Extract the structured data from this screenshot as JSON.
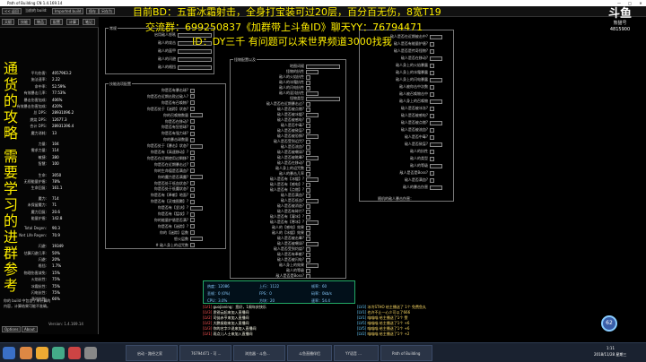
{
  "window": {
    "title": "Path of Building CN 1.4.169.14",
    "controls": [
      "—",
      "□",
      "✕"
    ]
  },
  "toolbar": {
    "buttons": [
      "<< 返回",
      "当前的 build:",
      "Imported build",
      "保存",
      "另存为",
      "天赋",
      "技能",
      "物品",
      "配置",
      "计算",
      "笔记"
    ]
  },
  "left_stats": [
    {
      "k": "平均伤害:",
      "v": "4057963.2"
    },
    {
      "k": "施法速率:",
      "v": "2.22"
    },
    {
      "k": "命中率:",
      "v": "52.59%"
    },
    {
      "k": "有效暴击几率:",
      "v": "77.53%"
    },
    {
      "k": "暴击伤害加成:",
      "v": "406%"
    },
    {
      "k": "有效暴击伤害加成:",
      "v": "420%"
    },
    {
      "k": "总 DPS:",
      "v": "28931096.2"
    },
    {
      "k": "燃烧 DPS:",
      "v": "12677.3"
    },
    {
      "k": "合计 DPS:",
      "v": "28931396.4"
    },
    {
      "k": "魔力消耗:",
      "v": "13"
    },
    {
      "k": "力量:",
      "v": "104"
    },
    {
      "k": "需求力量:",
      "v": "114"
    },
    {
      "k": "敏捷:",
      "v": "380"
    },
    {
      "k": "智慧:",
      "v": "100"
    },
    {
      "k": "生命:",
      "v": "3050"
    },
    {
      "k": "无视能量护盾:",
      "v": "78%"
    },
    {
      "k": "生命回复:",
      "v": "161.1"
    },
    {
      "k": "魔力:",
      "v": "714"
    },
    {
      "k": "未保留魔力:",
      "v": "71"
    },
    {
      "k": "魔力回复:",
      "v": "20.6"
    },
    {
      "k": "能量护盾:",
      "v": "142.8"
    },
    {
      "k": "Total Degen:",
      "v": "90.3"
    },
    {
      "k": "Net Life Regen:",
      "v": "70.9"
    },
    {
      "k": "闪避:",
      "v": "19349"
    },
    {
      "k": "估算闪避几率:",
      "v": "50%"
    },
    {
      "k": "闪避:",
      "v": "20%"
    },
    {
      "k": "格挡:",
      "v": "1.7%"
    },
    {
      "k": "物理伤害减免:",
      "v": "15%"
    },
    {
      "k": "火焰抗性:",
      "v": "75%"
    },
    {
      "k": "冰霜抗性:",
      "v": "75%"
    },
    {
      "k": "闪电抗性:",
      "v": "75%"
    },
    {
      "k": "混沌抗性:",
      "v": "66%"
    }
  ],
  "left_footer": {
    "msg1": "你的 build 中包含了未计算的",
    "msg2": "内容，计算结果可能不准确。",
    "version": "Version: 1.4.169.14",
    "options": "Options",
    "about": "About"
  },
  "panels": {
    "p1_title": "常规",
    "p1_rows": [
      "启用敌人怒吼",
      "敌人的攻击",
      "敌人的盔甲",
      "敌人的闪避",
      "敌人的格挡"
    ],
    "p2_title": "技能选项配置",
    "p2_rows": [
      "你是否有暴击球?",
      "你是否在近期击败过敌人?",
      "你是否有召唤物?",
      "你是否处于【迷踪】状态?",
      "你的召唤物数量",
      "你是否在移动?",
      "你是否有狂怒球?",
      "你是否有强力球?",
      "你的暴击球数量",
      "你是否处于【暴击】状态?",
      "你是否有【高速移动】?",
      "你是否在近期使用过瞬移?",
      "你是否在近期暴击过?",
      "你的生命值是否满血?",
      "你的魔力是否满魔?",
      "你是否处于低血状态?",
      "你是否处于低魔状态?",
      "你是否有【奉献】地面?",
      "你是否有【灵魂图腾】?",
      "你是否有【坚决】?",
      "你是否有【猛攻】?",
      "你的能量护盾是否满?",
      "你是否有【迷踪】?",
      "你的【迷踪】层数",
      "怒火层数",
      "# 敌人身上的诅咒数"
    ],
    "p3_title": "怪物配置以及",
    "p3_rows": [
      "地图词缀",
      "怪物的抗性",
      "敌人的火焰抗性",
      "敌人的冰霜抗性",
      "敌人的闪电抗性",
      "敌人的混沌抗性",
      "怪物类型",
      "敌人是否在近期暴击过?",
      "敌人是否被点燃?",
      "敌人是否被冰缓?",
      "敌人是否被感电?",
      "敌人是否中毒?",
      "敌人是否被致盲?",
      "敌人是否被恐惧?",
      "敌人是否受到诅咒?",
      "敌人是否流血?",
      "敌人是否被嘲讽?",
      "敌人是否被眩晕?",
      "敌人是否在移动?",
      "敌人身上的诅咒数",
      "敌人的暴击几率",
      "敌人是否有【冰缓】?",
      "敌人是否有【感电】?",
      "敌人是否有【点燃】?",
      "敌人是否满血?",
      "敌人是否低血?",
      "敌人是否被消逝?",
      "敌人是否有碎片?",
      "敌人是否有【凝冰】?",
      "敌人是否有【寒冰】?",
      "敌人的【感电】效果",
      "敌人的【冰缓】效果",
      "敌人是否被击晕?",
      "敌人是否被嘲讽?",
      "敌人是否受到灼烧?",
      "敌人是否有奉献?",
      "敌人是否被闪电?",
      "敌人身上的效果",
      "敌人的等级",
      "敌人是否是Boss?"
    ],
    "p4_rows": [
      "敌人是否在近期被击中?",
      "敌人是否有能量护盾?",
      "敌人是否是传奇怪物?",
      "敌人是否在移动?",
      "敌人身上的火焰暴露",
      "敌人身上的冰霜暴露",
      "敌人身上的闪电暴露",
      "敌人被你击中次数",
      "敌人被召唤物击中",
      "敌人身上的召唤物",
      "敌人是否被冰冻?",
      "敌人是否被感电?",
      "敌人是否被点燃?",
      "敌人是否被流血?",
      "敌人是否中毒?",
      "敌人是否致盲?",
      "敌人的抗性",
      "敌人的类型",
      "敌人的等级",
      "敌人是否是Boss?",
      "敌人是否满血?",
      "敌人的暴击伤害"
    ],
    "p4_dropdown": "保持 Boss（Shaper等）",
    "p4_footer": "随机的敌人暴击伤害："
  },
  "overlay": {
    "line1": "目前BD：五雷冰霜射击，全身打宝装可过20层，百分百无伤，8宽T19",
    "line2": "交流群：699250837《加群带上斗鱼ID》聊天YY：76794471",
    "line3": "ID：DY三千  有问题可以来世界频道3000找我",
    "vert1": "通货的攻略",
    "vert2": "需要学习的进群参考",
    "brand": "斗鱼",
    "brand_sub": "熊猫号",
    "room": "4815900"
  },
  "stream_stats": {
    "items": [
      "热度：12086",
      "上行：1122",
      "帧率：60",
      "丢帧：0 (0%)",
      "FPS：0",
      "码率：0kb/s",
      "CPU：3.0%",
      "方块：20",
      "速率：54.4"
    ]
  },
  "chat_log": [
    {
      "tag": "[LV1]",
      "text": "guojianing：您好，1周年庆快乐"
    },
    {
      "tag": "[LV3]",
      "text": "思锐云起来加入直播间"
    },
    {
      "tag": "[LV2]",
      "text": "司徒赤亨来加入直播间"
    },
    {
      "tag": "[LV2]",
      "text": "大鹏振翅来加入直播间"
    },
    {
      "tag": "[LV3]",
      "text": "你的名字少说来加入直播间"
    },
    {
      "tag": "[LV1]",
      "text": "雨点儿人士来加入直播间"
    }
  ],
  "chat_right": [
    {
      "tag": "[LV3]",
      "text": "冰冷STHO 给主播送了 1个 免费鱼丸"
    },
    {
      "tag": "[LV1]",
      "text": "也许不止一心少可以了666"
    },
    {
      "tag": "[LV1]",
      "text": "喵喵喵 给主播送了1个 赞"
    },
    {
      "tag": "[LV5]",
      "text": "喵喵喵 给主播送了1个 +6"
    },
    {
      "tag": "[LV5]",
      "text": "喵喵喵 给主播送了1个 +6"
    },
    {
      "tag": "[LV2]",
      "text": "喵喵喵 给主播送了1个 +2"
    }
  ],
  "taskbar": {
    "items": [
      "启动 - 路径之家",
      "76794471 - 可 ...",
      "浏览器 - 斗鱼...",
      "斗鱼直播伴侣",
      "YY语音 ...",
      "Path of Building"
    ],
    "time": "1:11",
    "date": "2018/11/28 星期三",
    "badge": "62"
  }
}
